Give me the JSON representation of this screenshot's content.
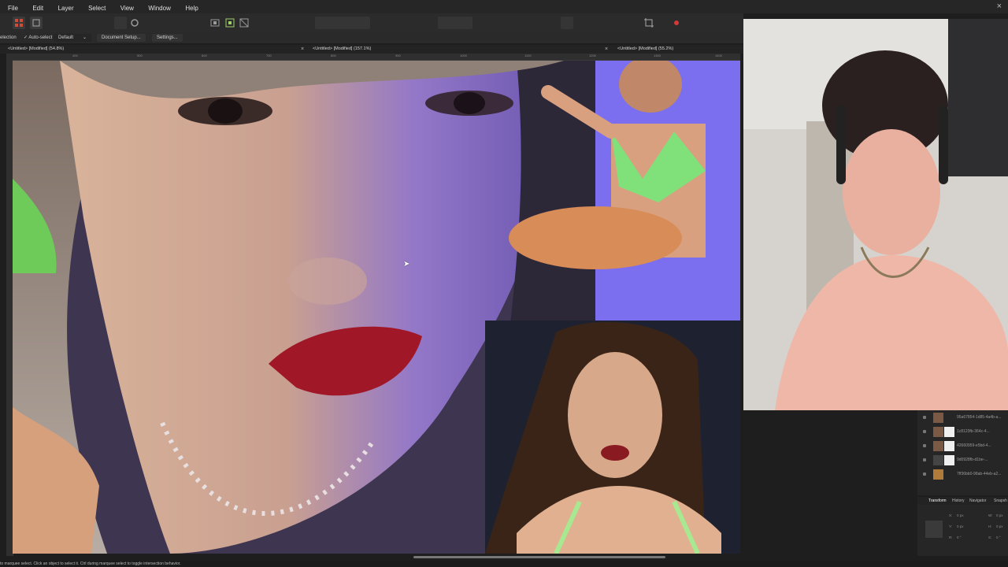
{
  "menu": [
    "File",
    "Edit",
    "Layer",
    "Select",
    "View",
    "Window",
    "Help"
  ],
  "window": {
    "close_glyph": "×"
  },
  "context_bar": {
    "selection_label": "election",
    "auto_select_label": "Auto-select",
    "auto_select_value": "Default",
    "document_setup": "Document Setup...",
    "settings": "Settings..."
  },
  "tabs": [
    {
      "title": "<Untitled> [Modified] (54.8%)"
    },
    {
      "title": "<Untitled> [Modified] (157.1%)"
    },
    {
      "title": "<Untitled> [Modified] (55.2%)"
    }
  ],
  "tab_close_glyph": "×",
  "ruler_ticks": [
    "400",
    "500",
    "600",
    "700",
    "800",
    "900",
    "1000",
    "1100",
    "1200",
    "1300",
    "1400"
  ],
  "layers": [
    {
      "name": "95a67854-1d85-4a4b-a..."
    },
    {
      "name": "1c8123fb-364c-4..."
    },
    {
      "name": "42660959-e5bd-4..."
    },
    {
      "name": "9d0928fb-d1be-..."
    },
    {
      "name": "7ff36bb0-98ab-44eb-a2..."
    }
  ],
  "panel_tabs": [
    "Transform",
    "History",
    "Navigator",
    "Snapsh"
  ],
  "transform": {
    "x_label": "X:",
    "x_value": "0 px",
    "y_label": "Y:",
    "y_value": "0 px",
    "w_label": "W:",
    "w_value": "0 px",
    "h_label": "H:",
    "h_value": "0 px",
    "r_label": "R:",
    "r_value": "0 °",
    "s_label": "S:",
    "s_value": "0 °"
  },
  "status": {
    "text": "to marquee select. Click an object to select it. Ctrl during marquee select to toggle intersection behavior."
  },
  "colors": {
    "menubar": "#262626",
    "toolbar": "#2b2b2b",
    "accent": "#2f7bd8"
  }
}
